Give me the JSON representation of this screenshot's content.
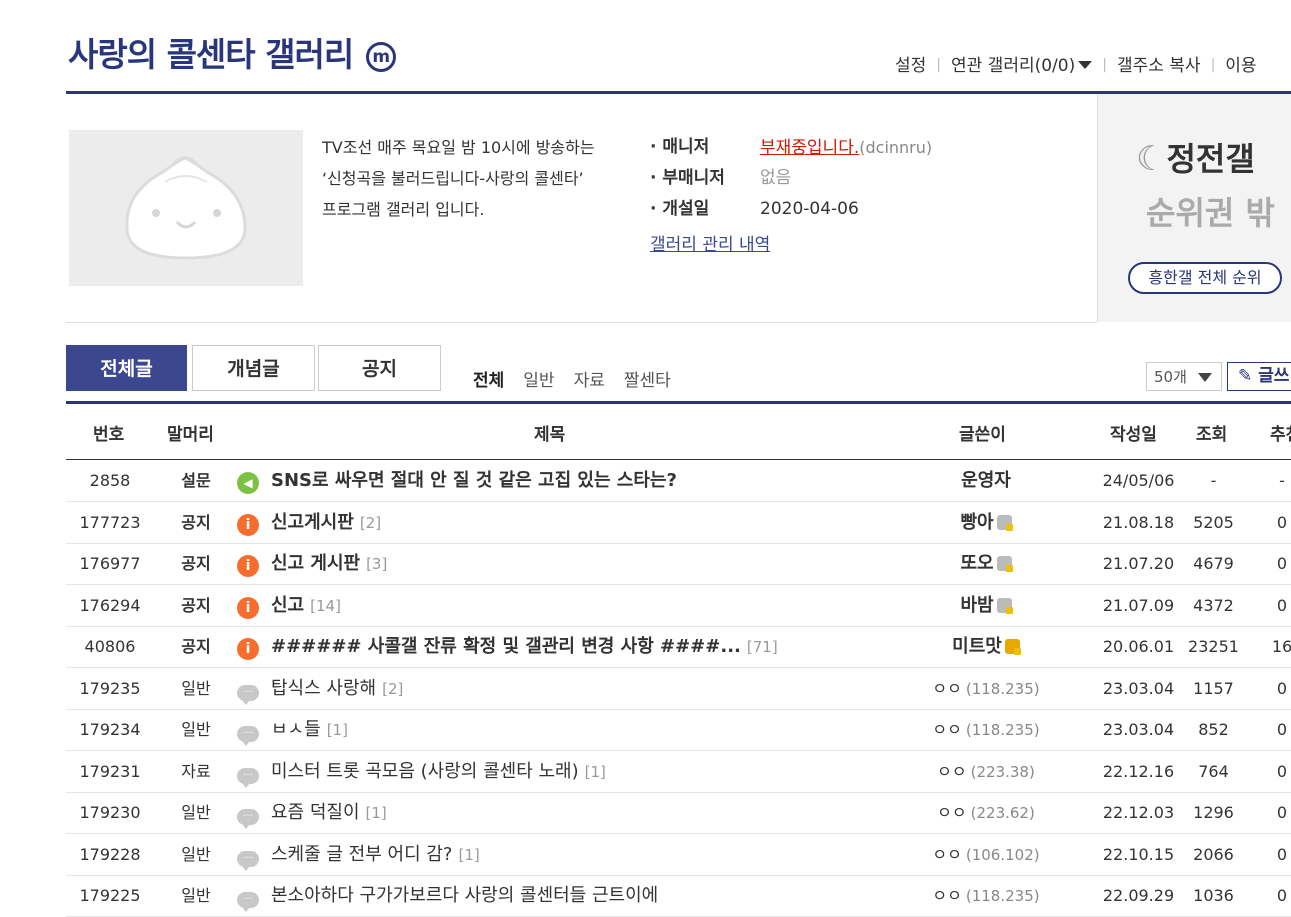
{
  "header": {
    "title": "사랑의 콜센타 갤러리",
    "badge": "m",
    "links": {
      "settings": "설정",
      "related": "연관 갤러리(0/0)",
      "copy_address": "갤주소 복사",
      "usage": "이용"
    }
  },
  "gallery_info": {
    "description": "TV조선 매주 목요일 밤 10시에 방송하는\n‘신청곡을 불러드립니다-사랑의 콜센타’\n프로그램 갤러리 입니다.",
    "manager_label": "매니저",
    "manager_value": "부재중입니다.",
    "manager_id": "(dcinnru)",
    "submanager_label": "부매니저",
    "submanager_value": "없음",
    "opened_label": "개설일",
    "opened_value": "2020-04-06",
    "history_link": "갤러리 관리 내역"
  },
  "rank": {
    "line1": "정전갤",
    "line2": "순위권 밖",
    "button": "흥한갤 전체 순위"
  },
  "tabs": [
    "전체글",
    "개념글",
    "공지"
  ],
  "subtabs": [
    "전체",
    "일반",
    "자료",
    "짤센타"
  ],
  "list_controls": {
    "page_size": "50개",
    "write": "글쓰"
  },
  "columns": {
    "num": "번호",
    "head": "말머리",
    "title": "제목",
    "writer": "글쓴이",
    "date": "작성일",
    "views": "조회",
    "rec": "추천"
  },
  "rows": [
    {
      "num": "2858",
      "head": "설문",
      "icon": "speaker-icon",
      "title": "SNS로 싸우면 절대 안 질 것 같은 고집 있는 스타는?",
      "comments": "",
      "writer": "운영자",
      "ip": "",
      "badge": "",
      "date": "24/05/06",
      "views": "-",
      "rec": "-",
      "bold": true
    },
    {
      "num": "177723",
      "head": "공지",
      "icon": "notice-icon",
      "title": "신고게시판",
      "comments": "[2]",
      "writer": "빵아",
      "ip": "",
      "badge": "gray",
      "date": "21.08.18",
      "views": "5205",
      "rec": "0",
      "bold": true
    },
    {
      "num": "176977",
      "head": "공지",
      "icon": "notice-icon",
      "title": "신고 게시판",
      "comments": "[3]",
      "writer": "또오",
      "ip": "",
      "badge": "gray",
      "date": "21.07.20",
      "views": "4679",
      "rec": "0",
      "bold": true
    },
    {
      "num": "176294",
      "head": "공지",
      "icon": "notice-icon",
      "title": "신고",
      "comments": "[14]",
      "writer": "바밤",
      "ip": "",
      "badge": "gray",
      "date": "21.07.09",
      "views": "4372",
      "rec": "0",
      "bold": true
    },
    {
      "num": "40806",
      "head": "공지",
      "icon": "notice-icon",
      "title": "###### 사콜갤 잔류 확정 및 갤관리 변경 사항 ####...",
      "comments": "[71]",
      "writer": "미트맛",
      "ip": "",
      "badge": "gold",
      "date": "20.06.01",
      "views": "23251",
      "rec": "16",
      "bold": true
    },
    {
      "num": "179235",
      "head": "일반",
      "icon": "chat-icon",
      "title": "탑식스 사랑해",
      "comments": "[2]",
      "writer": "ㅇㅇ",
      "ip": "(118.235)",
      "badge": "",
      "date": "23.03.04",
      "views": "1157",
      "rec": "0",
      "bold": false
    },
    {
      "num": "179234",
      "head": "일반",
      "icon": "chat-icon",
      "title": "ㅂㅅ들",
      "comments": "[1]",
      "writer": "ㅇㅇ",
      "ip": "(118.235)",
      "badge": "",
      "date": "23.03.04",
      "views": "852",
      "rec": "0",
      "bold": false
    },
    {
      "num": "179231",
      "head": "자료",
      "icon": "chat-icon",
      "title": "미스터 트롯 곡모음 (사랑의 콜센타 노래)",
      "comments": "[1]",
      "writer": "ㅇㅇ",
      "ip": "(223.38)",
      "badge": "",
      "date": "22.12.16",
      "views": "764",
      "rec": "0",
      "bold": false
    },
    {
      "num": "179230",
      "head": "일반",
      "icon": "chat-icon",
      "title": "요즘 덕질이",
      "comments": "[1]",
      "writer": "ㅇㅇ",
      "ip": "(223.62)",
      "badge": "",
      "date": "22.12.03",
      "views": "1296",
      "rec": "0",
      "bold": false
    },
    {
      "num": "179228",
      "head": "일반",
      "icon": "chat-icon",
      "title": "스케줄 글 전부 어디 감?",
      "comments": "[1]",
      "writer": "ㅇㅇ",
      "ip": "(106.102)",
      "badge": "",
      "date": "22.10.15",
      "views": "2066",
      "rec": "0",
      "bold": false
    },
    {
      "num": "179225",
      "head": "일반",
      "icon": "chat-icon",
      "title": "본소아하다 구가가보르다 사랑의 콜센터들 근트이에",
      "comments": "",
      "writer": "ㅇㅇ",
      "ip": "(118.235)",
      "badge": "",
      "date": "22.09.29",
      "views": "1036",
      "rec": "0",
      "bold": false
    }
  ]
}
